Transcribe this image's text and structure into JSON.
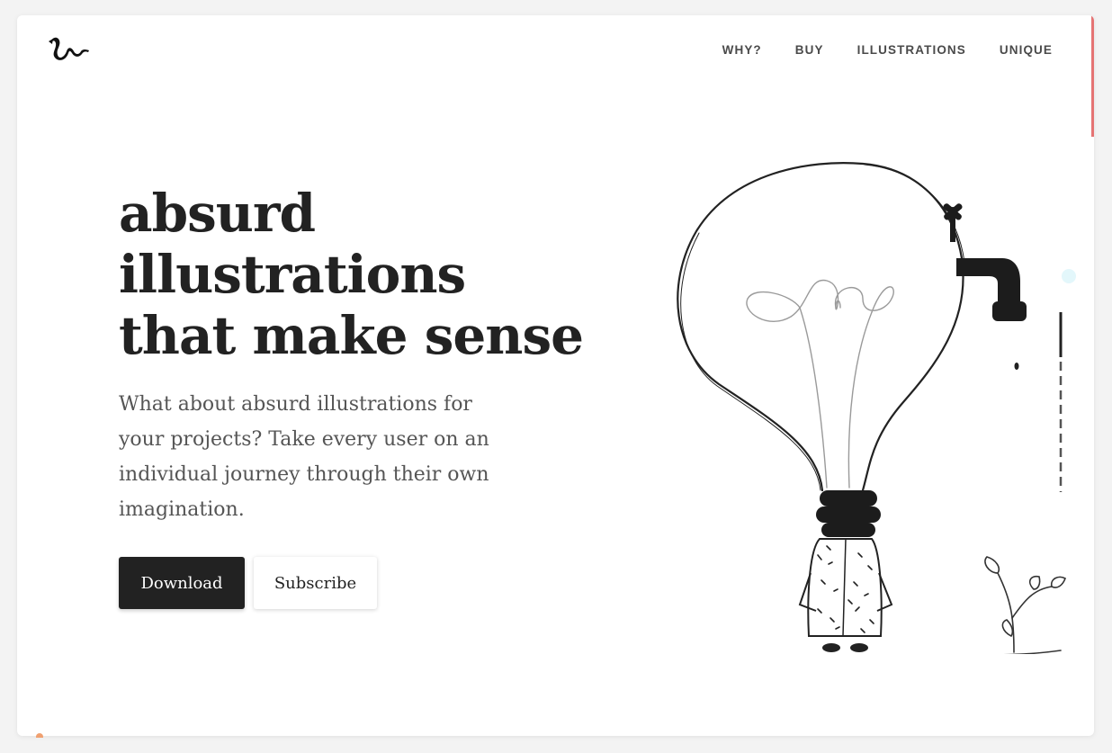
{
  "nav": {
    "items": [
      {
        "label": "WHY?"
      },
      {
        "label": "BUY"
      },
      {
        "label": "ILLUSTRATIONS"
      },
      {
        "label": "UNIQUE"
      }
    ]
  },
  "hero": {
    "title_lines": [
      "absurd",
      "illustrations",
      "that make sense"
    ],
    "description": "What about absurd illustrations for your projects? Take every user on an individual journey through their own imagination."
  },
  "buttons": {
    "download_label": "Download",
    "subscribe_label": "Subscribe"
  },
  "icons": {
    "logo": "squiggle-logo-icon",
    "illustration": "lightbulb-person-faucet-plant-illustration"
  },
  "colors": {
    "primary_button": "#222222",
    "accent": "#e57373",
    "text": "#222222",
    "muted_text": "#555555"
  }
}
